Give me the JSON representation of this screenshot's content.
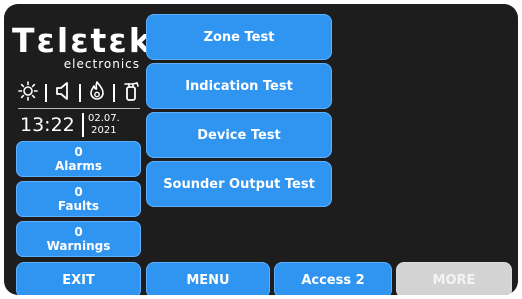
{
  "brand": {
    "name": "Tεlεtεk",
    "subtitle": "electronics"
  },
  "status_icons": [
    "sun-icon",
    "speaker-icon",
    "fire-icon",
    "extinguisher-icon"
  ],
  "clock": {
    "time": "13:22",
    "date_day": "02.07.",
    "date_year": "2021"
  },
  "counters": [
    {
      "count": "0",
      "label": "Alarms"
    },
    {
      "count": "0",
      "label": "Faults"
    },
    {
      "count": "0",
      "label": "Warnings"
    }
  ],
  "menu": [
    {
      "label": "Zone Test"
    },
    {
      "label": "Indication Test"
    },
    {
      "label": "Device Test"
    },
    {
      "label": "Sounder Output Test"
    }
  ],
  "bottom_bar": {
    "exit": "EXIT",
    "menu": "MENU",
    "access": "Access 2",
    "more": "MORE"
  },
  "colors": {
    "accent": "#2f95f1",
    "screen_background": "#1d1d1d",
    "disabled": "#d3d3d3"
  }
}
